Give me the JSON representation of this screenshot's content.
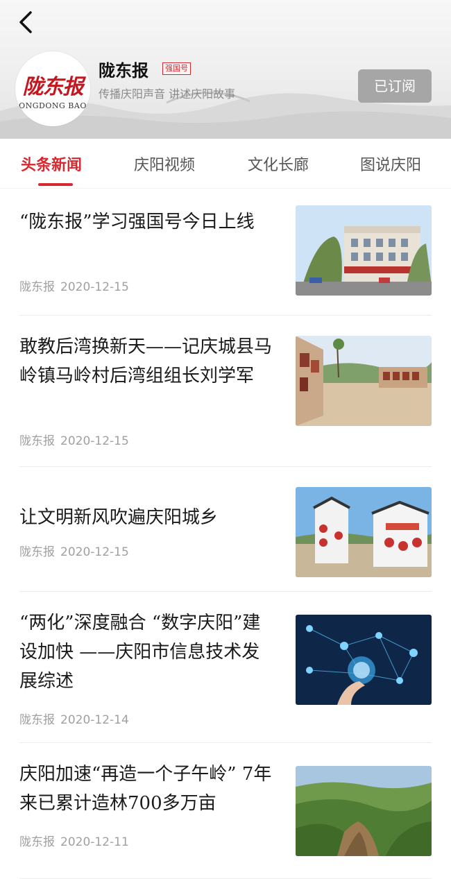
{
  "header": {
    "logo_script": "陇东报",
    "logo_latin": "ONGDONG BAO",
    "name": "陇东报",
    "badge": "强国号",
    "slogan": "传播庆阳声音 讲述庆阳故事",
    "subscribe_label": "已订阅"
  },
  "tabs": [
    {
      "label": "头条新闻",
      "active": true
    },
    {
      "label": "庆阳视频",
      "active": false
    },
    {
      "label": "文化长廊",
      "active": false
    },
    {
      "label": "图说庆阳",
      "active": false
    }
  ],
  "articles": [
    {
      "title": "“陇东报”学习强国号今日上线",
      "source": "陇东报",
      "date": "2020-12-15",
      "image": "office-building-photo"
    },
    {
      "title": "敢教后湾换新天——记庆城县马岭镇马岭村后湾组组长刘学军",
      "source": "陇东报",
      "date": "2020-12-15",
      "image": "village-square-photo"
    },
    {
      "title": "让文明新风吹遍庆阳城乡",
      "source": "陇东报",
      "date": "2020-12-15",
      "image": "culture-walls-photo"
    },
    {
      "title": "“两化”深度融合 “数字庆阳”建设加快 ——庆阳市信息技术发展综述",
      "source": "陇东报",
      "date": "2020-12-14",
      "image": "digital-tech-photo"
    },
    {
      "title": "庆阳加速“再造一个子午岭” 7年来已累计造林700多万亩",
      "source": "陇东报",
      "date": "2020-12-11",
      "image": "forest-hills-photo"
    }
  ],
  "colors": {
    "accent": "#d8282f",
    "subscribed": "#a6a6a6",
    "meta": "#a0a0a0"
  }
}
